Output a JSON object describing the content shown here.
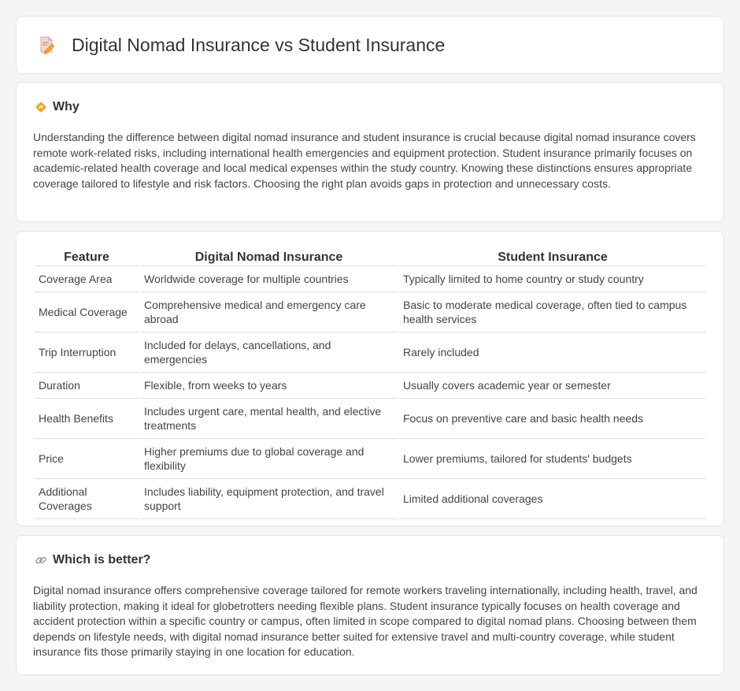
{
  "header": {
    "title": "Digital Nomad Insurance vs Student Insurance",
    "icon": "document-pencil-icon"
  },
  "why": {
    "title": "Why",
    "icon": "diamond-direction-icon",
    "body": "Understanding the difference between digital nomad insurance and student insurance is crucial because digital nomad insurance covers remote work-related risks, including international health emergencies and equipment protection. Student insurance primarily focuses on academic-related health coverage and local medical expenses within the study country. Knowing these distinctions ensures appropriate coverage tailored to lifestyle and risk factors. Choosing the right plan avoids gaps in protection and unnecessary costs."
  },
  "comparison": {
    "headers": [
      "Feature",
      "Digital Nomad Insurance",
      "Student Insurance"
    ],
    "rows": [
      [
        "Coverage Area",
        "Worldwide coverage for multiple countries",
        "Typically limited to home country or study country"
      ],
      [
        "Medical Coverage",
        "Comprehensive medical and emergency care abroad",
        "Basic to moderate medical coverage, often tied to campus health services"
      ],
      [
        "Trip Interruption",
        "Included for delays, cancellations, and emergencies",
        "Rarely included"
      ],
      [
        "Duration",
        "Flexible, from weeks to years",
        "Usually covers academic year or semester"
      ],
      [
        "Health Benefits",
        "Includes urgent care, mental health, and elective treatments",
        "Focus on preventive care and basic health needs"
      ],
      [
        "Price",
        "Higher premiums due to global coverage and flexibility",
        "Lower premiums, tailored for students' budgets"
      ],
      [
        "Additional Coverages",
        "Includes liability, equipment protection, and travel support",
        "Limited additional coverages"
      ]
    ]
  },
  "better": {
    "title": "Which is better?",
    "icon": "link-icon",
    "body": "Digital nomad insurance offers comprehensive coverage tailored for remote workers traveling internationally, including health, travel, and liability protection, making it ideal for globetrotters needing flexible plans. Student insurance typically focuses on health coverage and accident protection within a specific country or campus, often limited in scope compared to digital nomad plans. Choosing between them depends on lifestyle needs, with digital nomad insurance better suited for extensive travel and multi-country coverage, while student insurance fits those primarily staying in one location for education."
  },
  "colors": {
    "background": "#f5f5f5",
    "card": "#ffffff",
    "border": "#e4e4e4",
    "icon_orange": "#f4a623",
    "icon_pink": "#e07b7b"
  }
}
